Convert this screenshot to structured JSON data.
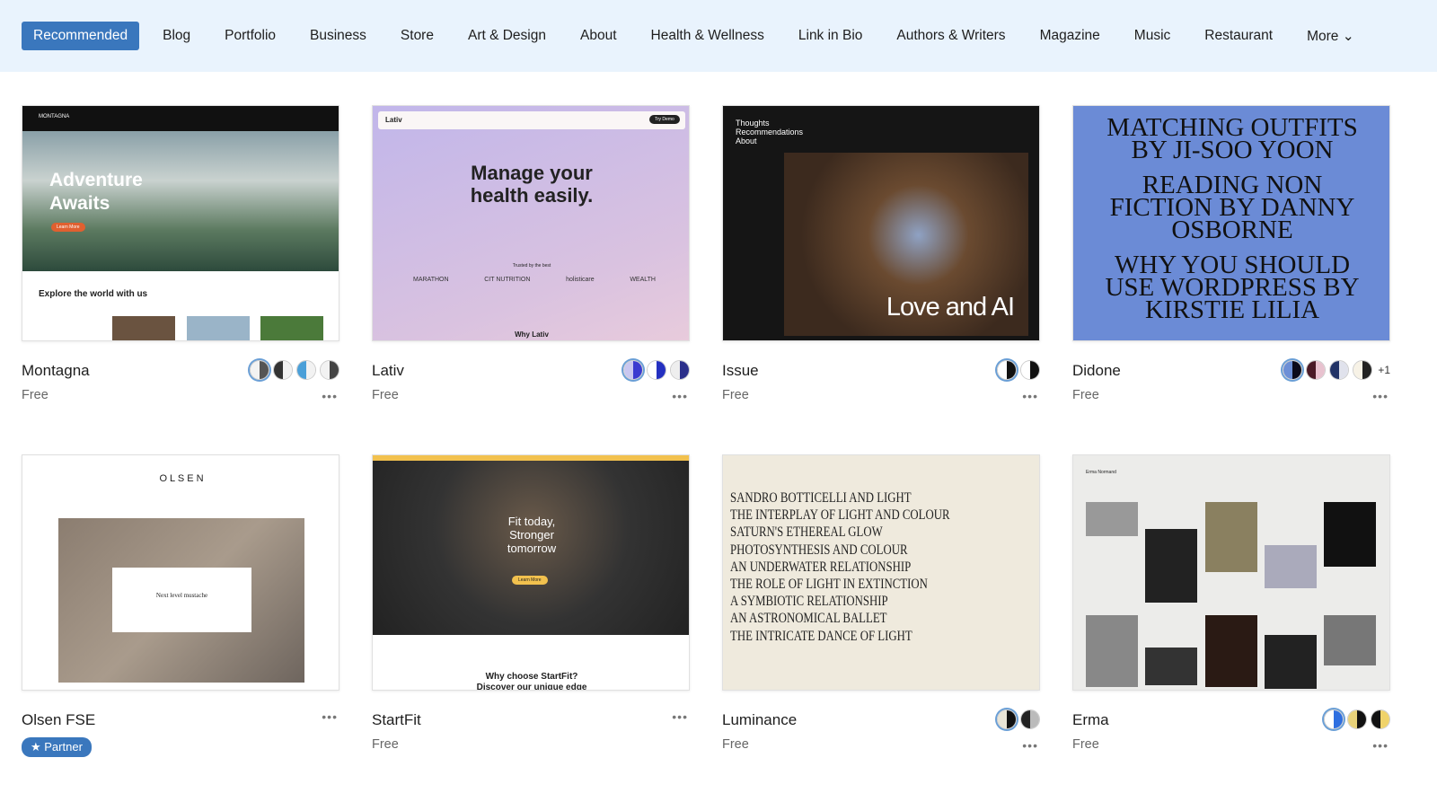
{
  "nav": {
    "tabs": [
      "Recommended",
      "Blog",
      "Portfolio",
      "Business",
      "Store",
      "Art & Design",
      "About",
      "Health & Wellness",
      "Link in Bio",
      "Authors & Writers",
      "Magazine",
      "Music",
      "Restaurant"
    ],
    "more": "More"
  },
  "themes": [
    {
      "name": "Montagna",
      "price": "Free",
      "preview": {
        "brand": "MONTAGNA",
        "headline": "Adventure Awaits",
        "button": "Learn More",
        "sub": "Explore the world with us"
      },
      "swatches": [
        [
          "#f2f2f2",
          "#555"
        ],
        [
          "#333",
          "#f2f2f2"
        ],
        [
          "#4a9fd8",
          "#f2f2f2"
        ],
        [
          "#f2f2f2",
          "#444"
        ]
      ]
    },
    {
      "name": "Lativ",
      "price": "Free",
      "preview": {
        "brand": "Lativ",
        "button": "Try Demo",
        "headline": "Manage your health easily.",
        "trusted": "Trusted by the best",
        "logos": [
          "MARATHON",
          "CIT NUTRITION",
          "holisticare",
          "WEALTH"
        ],
        "footer": "Why Lativ"
      },
      "swatches": [
        [
          "#c9c7f0",
          "#3b3bd0"
        ],
        [
          "#fff",
          "#2430c0"
        ],
        [
          "#eee",
          "#2b2f8a"
        ]
      ]
    },
    {
      "name": "Issue",
      "price": "Free",
      "preview": {
        "menu": [
          "Thoughts",
          "Recommendations",
          "About"
        ],
        "headline": "Love and AI"
      },
      "swatches": [
        [
          "#fff",
          "#111"
        ],
        [
          "#fff",
          "#111"
        ]
      ]
    },
    {
      "name": "Didone",
      "price": "Free",
      "preview": {
        "lines": [
          "MATCHING OUTFITS BY JI-SOO YOON",
          "READING NON FICTION BY DANNY OSBORNE",
          "WHY YOU SHOULD USE WORDPRESS BY KIRSTIE LILIA"
        ]
      },
      "swatches": [
        [
          "#6c8fd6",
          "#0b0b1a"
        ],
        [
          "#4a1a26",
          "#e8c2cf"
        ],
        [
          "#223366",
          "#e0e2ec"
        ],
        [
          "#f7f2e6",
          "#222"
        ]
      ],
      "extra": "+1"
    },
    {
      "name": "Olsen FSE",
      "badge": "★ Partner",
      "preview": {
        "brand": "O L S E N",
        "card": "Next level mustache"
      }
    },
    {
      "name": "StartFit",
      "price": "Free",
      "preview": {
        "headline": "Fit today, Stronger tomorrow",
        "button": "Learn More",
        "footer": "Why choose StartFit? Discover our unique edge"
      }
    },
    {
      "name": "Luminance",
      "price": "Free",
      "preview": {
        "lines": [
          "SANDRO BOTTICELLI AND LIGHT",
          "THE INTERPLAY OF LIGHT AND COLOUR",
          "SATURN'S ETHEREAL GLOW",
          "PHOTOSYNTHESIS AND COLOUR",
          "AN UNDERWATER RELATIONSHIP",
          "THE ROLE OF LIGHT IN EXTINCTION",
          "A SYMBIOTIC RELATIONSHIP",
          "AN ASTRONOMICAL BALLET",
          "THE INTRICATE DANCE OF LIGHT"
        ]
      },
      "swatches": [
        [
          "#e8e4d6",
          "#111"
        ],
        [
          "#222",
          "#bbb"
        ]
      ]
    },
    {
      "name": "Erma",
      "price": "Free",
      "preview": {
        "brand": "Erma Normand"
      },
      "swatches": [
        [
          "#fff",
          "#2f6fe0"
        ],
        [
          "#e8d27a",
          "#111"
        ],
        [
          "#111",
          "#f0d36a"
        ]
      ]
    }
  ]
}
